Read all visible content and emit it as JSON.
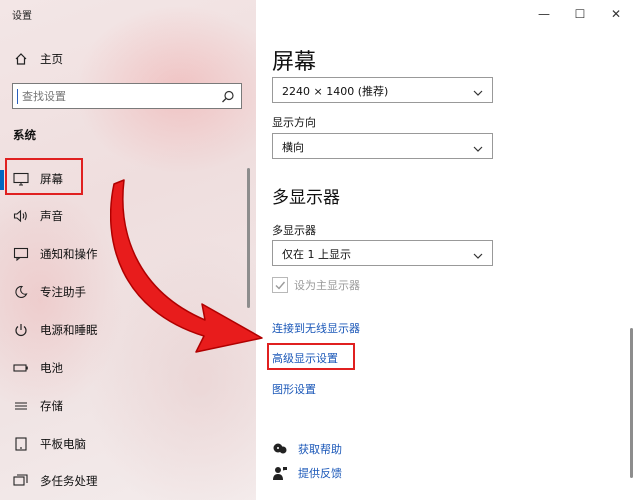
{
  "app": {
    "title": "设置"
  },
  "window": {
    "minimize": "—",
    "maximize": "☐",
    "close": "✕"
  },
  "sidebar": {
    "home_label": "主页",
    "search_placeholder": "查找设置",
    "section": "系统",
    "items": [
      {
        "label": "屏幕",
        "icon": "monitor-icon",
        "selected": true
      },
      {
        "label": "声音",
        "icon": "speaker-icon"
      },
      {
        "label": "通知和操作",
        "icon": "notification-icon"
      },
      {
        "label": "专注助手",
        "icon": "moon-icon"
      },
      {
        "label": "电源和睡眠",
        "icon": "power-icon"
      },
      {
        "label": "电池",
        "icon": "battery-icon"
      },
      {
        "label": "存储",
        "icon": "storage-icon"
      },
      {
        "label": "平板电脑",
        "icon": "tablet-icon"
      },
      {
        "label": "多任务处理",
        "icon": "multitask-icon"
      }
    ]
  },
  "main": {
    "title": "屏幕",
    "resolution_value": "2240 × 1400 (推荐)",
    "orientation_label": "显示方向",
    "orientation_value": "横向",
    "multi_heading": "多显示器",
    "multi_label": "多显示器",
    "multi_value": "仅在 1 上显示",
    "main_display_checkbox": "设为主显示器",
    "main_display_checked": true,
    "main_display_disabled": true,
    "links": {
      "wireless": "连接到无线显示器",
      "advanced": "高级显示设置",
      "graphics": "图形设置"
    },
    "help": {
      "get_help": "获取帮助",
      "feedback": "提供反馈"
    }
  },
  "colors": {
    "accent": "#0067c0",
    "link": "#1a57b8",
    "annotation_red": "#e02020"
  }
}
